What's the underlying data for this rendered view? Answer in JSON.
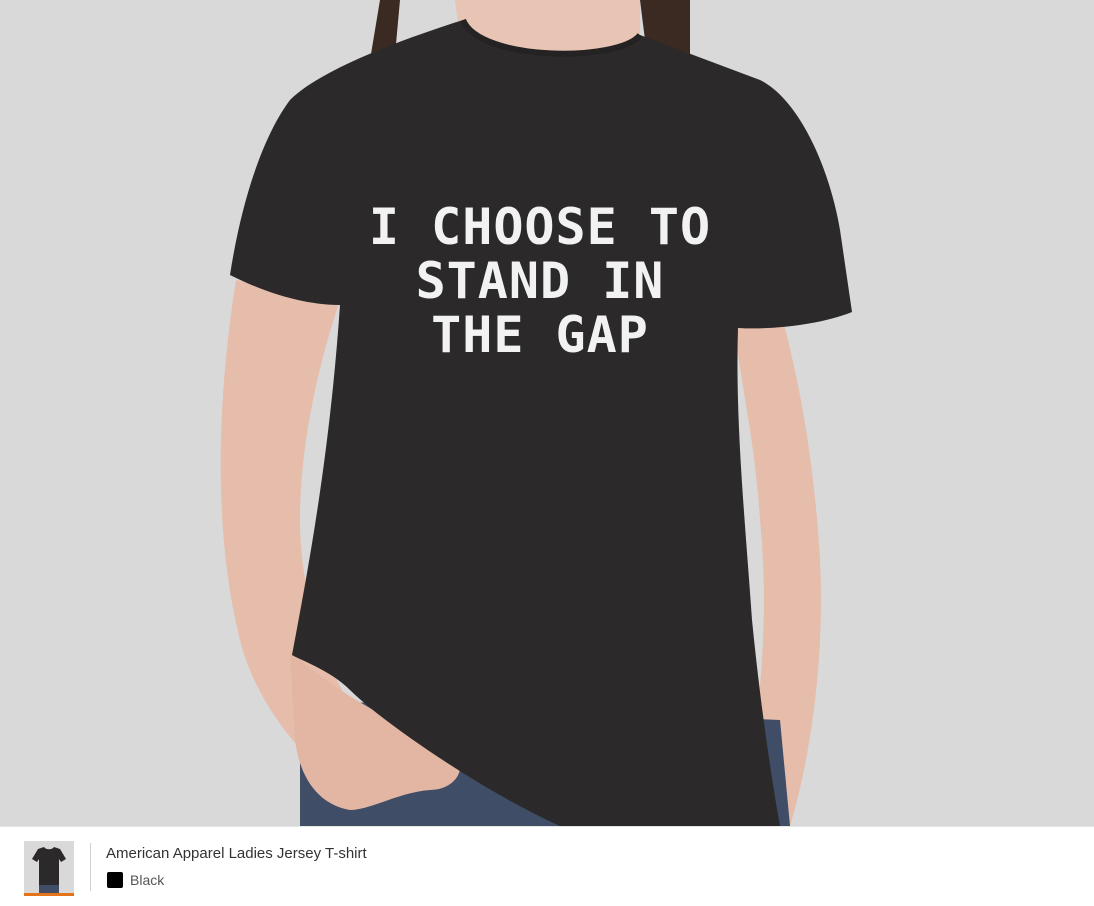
{
  "product_preview": {
    "print_lines": [
      "I CHOOSE TO",
      "STAND IN",
      "THE GAP"
    ],
    "background_color": "#d9d9d9",
    "shirt_color": "#2b2929"
  },
  "product_bar": {
    "product_name": "American Apparel Ladies Jersey T-shirt",
    "color_label": "Black",
    "color_hex": "#000000",
    "thumbnail_accent": "#e5731c"
  }
}
